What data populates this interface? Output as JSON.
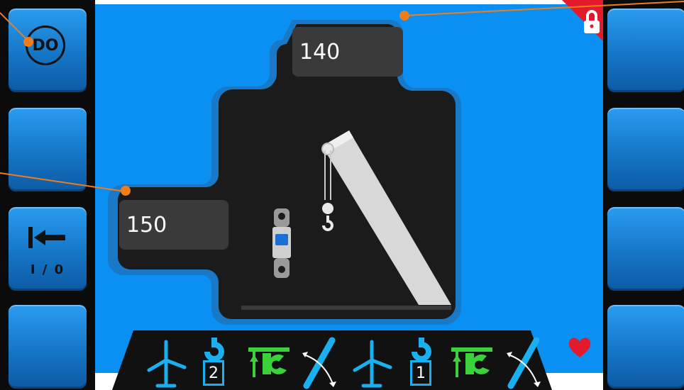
{
  "left_buttons": [
    {
      "label": "DO",
      "icon": "do-circle-icon"
    },
    {
      "label": ""
    },
    {
      "label": "I / 0",
      "icon": "arrow-left-bar-icon"
    },
    {
      "label": ""
    }
  ],
  "right_buttons": [
    "",
    "",
    "",
    ""
  ],
  "values": {
    "top": "140",
    "left": "150"
  },
  "status_bar": {
    "groups": [
      {
        "wind": "wind-turbine-icon",
        "hook_number": "2",
        "load": "load-green-icon",
        "boom": "boom-angle-icon"
      },
      {
        "wind": "wind-turbine-icon",
        "hook_number": "1",
        "load": "load-green-icon",
        "boom": "boom-angle-icon"
      }
    ]
  },
  "indicators": {
    "lock": "lock-icon",
    "heart": "heart-icon"
  },
  "colors": {
    "screen": "#0a8ff2",
    "accent_orange": "#ef7d1a",
    "icon_blue": "#1ab0f0",
    "icon_green": "#3bd13b",
    "heart": "#e21a2b",
    "lock_red": "#e21a2b"
  }
}
